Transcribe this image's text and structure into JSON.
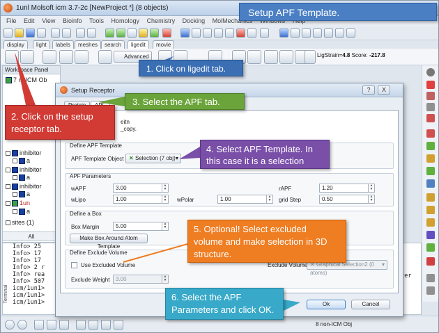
{
  "window": {
    "title": "1unl Molsoft icm 3.7-2c  [NewProject *] (8 objects)"
  },
  "menu": [
    "File",
    "Edit",
    "View",
    "Bioinfo",
    "Tools",
    "Homology",
    "Chemistry",
    "Docking",
    "MolMechanics",
    "Windows",
    "Help"
  ],
  "panel_tabs": [
    "display",
    "light",
    "labels",
    "meshes",
    "search",
    "ligedit",
    "movie"
  ],
  "toolbar2": {
    "advanced_label": "Advanced",
    "ligstrain_label": "LigStrain=",
    "ligstrain_value": "4.8",
    "score_label": "Score:",
    "score_value": "-217.8"
  },
  "workspace": {
    "title": "Workspace Panel",
    "header": "7 m   ICM Ob",
    "items": [
      "inhibitor",
      "a",
      "inhibitor",
      "a",
      "inhibitor",
      "a",
      "inhibitor",
      "a",
      "1un",
      "a",
      "sites  (1)"
    ],
    "all_label": "All"
  },
  "terminal": {
    "vertical_label": "Terminal",
    "lines": [
      "Info> 25",
      "Info> 17",
      "Info> 17",
      "Info> 2 r",
      "Info> rea",
      "Info> 507",
      "icm/1un1>",
      "icm/1un1>",
      "icm/1un1>"
    ],
    "right_fragment": "ater"
  },
  "statusbar": {
    "objects_text": "8 non-ICM Obj"
  },
  "dialog": {
    "title": "Setup Receptor",
    "help": "?",
    "close": "X",
    "tabs": [
      "Protein",
      "APF"
    ],
    "active_tab": "APF",
    "info_lines": [
      "eitn",
      "_copy."
    ],
    "template": {
      "group_title": "Define APF Template",
      "label": "APF Template Object",
      "value": "Selection (7 obj)"
    },
    "params": {
      "group_title": "APF Parameters",
      "wAPF_label": "wAPF",
      "wAPF_value": "3.00",
      "rAPF_label": "rAPF",
      "rAPF_value": "1.20",
      "wLipo_label": "wLipo",
      "wLipo_value": "1.00",
      "wPolar_label": "wPolar",
      "wPolar_value": "1.00",
      "gridstep_label": "grid Step",
      "gridstep_value": "0.50"
    },
    "box": {
      "group_title": "Define a Box",
      "margin_label": "Box Margin",
      "margin_value": "5.00",
      "make_box_button": "Make Box Around Atom Template"
    },
    "exclude": {
      "group_title": "Define Exclude Volume",
      "use_label": "Use Excluded Volume",
      "volume_label": "Exclude Volume",
      "volume_value": "Graphical Selection2 (0 atoms)",
      "weight_label": "Exclude Weight",
      "weight_value": "3.00"
    },
    "ok": "Ok",
    "cancel": "Cancel"
  },
  "callouts": {
    "title": "Setup APF Template.",
    "step1": "1. Click on ligedit tab.",
    "step2": "2. Click on the setup\nreceptor tab.",
    "step3": "3. Select the APF tab.",
    "step4": "4. Select APF Template. In\nthis case it is a selection",
    "step5": "5. Optional! Select excluded\nvolume and make selection in 3D\nstructure.",
    "step6": "6. Select the APF\nParameters and click OK."
  },
  "colors": {
    "callout_blue": "#3b6fb4",
    "callout_green": "#6aa43a",
    "callout_red": "#d23a34",
    "callout_purple": "#7a4fa8",
    "callout_orange": "#ef7d22",
    "callout_cyan": "#38a9c9"
  }
}
